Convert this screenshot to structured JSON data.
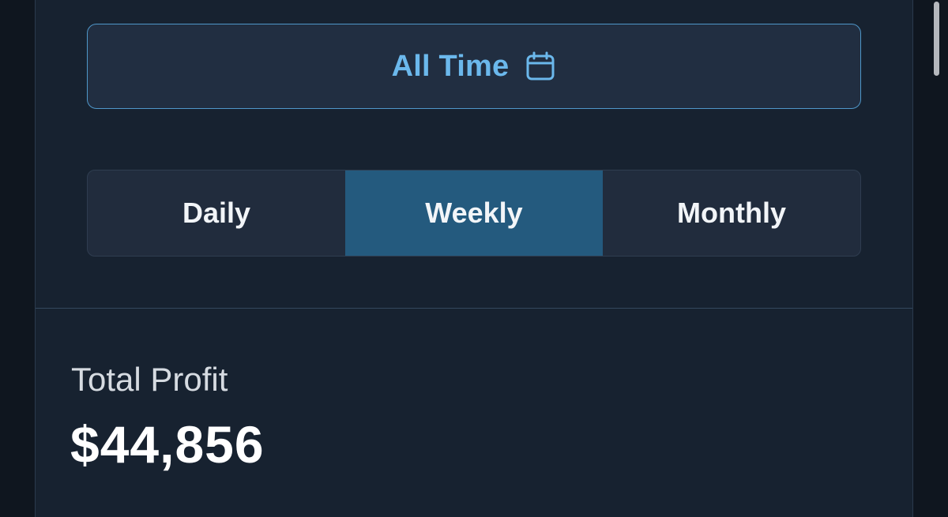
{
  "range": {
    "label": "All Time",
    "icon": "calendar-icon",
    "accent_color": "#6bb8ec"
  },
  "period_tabs": {
    "items": [
      {
        "label": "Daily",
        "selected": false
      },
      {
        "label": "Weekly",
        "selected": true
      },
      {
        "label": "Monthly",
        "selected": false
      }
    ],
    "selected_color": "#245a7e"
  },
  "stats": {
    "total_profit_label": "Total Profit",
    "total_profit_value": "$44,856"
  }
}
